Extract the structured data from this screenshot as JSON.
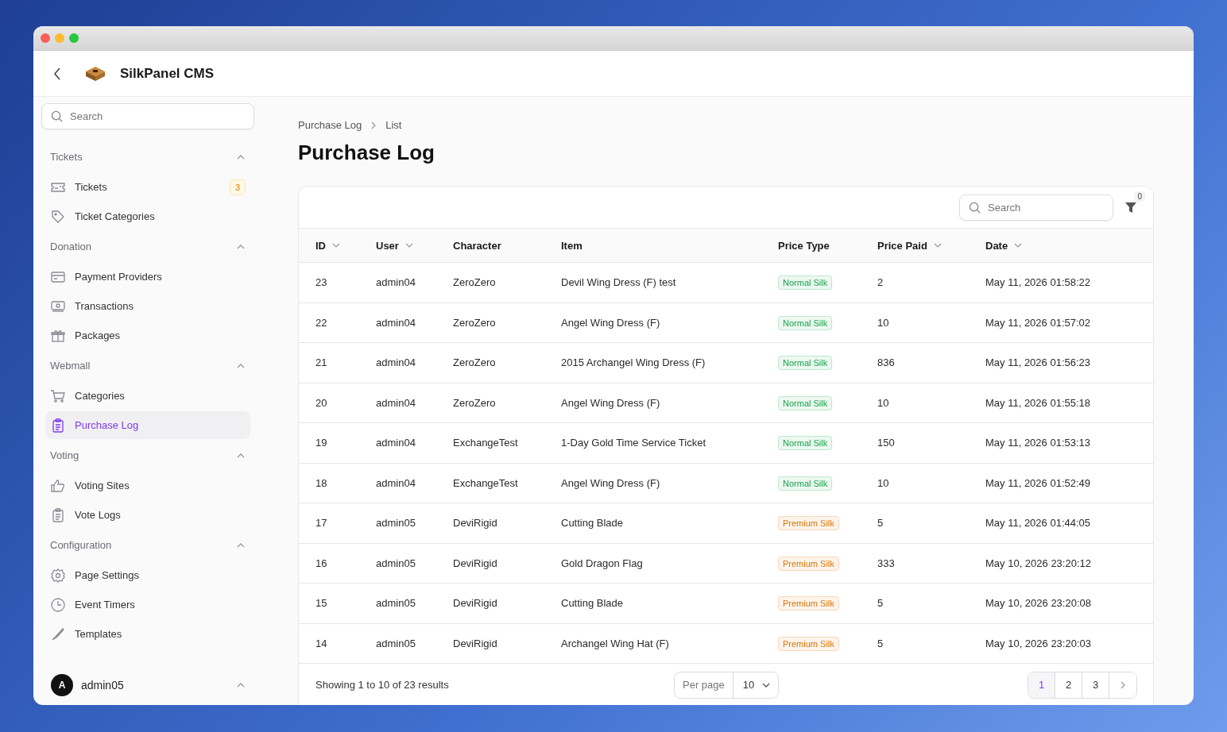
{
  "app": {
    "title": "SilkPanel CMS"
  },
  "sidebar": {
    "search": {
      "placeholder": "Search"
    },
    "groups": [
      {
        "label": "Tickets",
        "expanded": true,
        "items": [
          {
            "label": "Tickets",
            "selected": false,
            "badge": "3"
          },
          {
            "label": "Ticket Categories",
            "selected": false
          }
        ]
      },
      {
        "label": "Donation",
        "expanded": true,
        "items": [
          {
            "label": "Payment Providers",
            "selected": false
          },
          {
            "label": "Transactions",
            "selected": false
          },
          {
            "label": "Packages",
            "selected": false
          }
        ]
      },
      {
        "label": "Webmall",
        "expanded": true,
        "items": [
          {
            "label": "Categories",
            "selected": false
          },
          {
            "label": "Purchase Log",
            "selected": true
          }
        ]
      },
      {
        "label": "Voting",
        "expanded": true,
        "items": [
          {
            "label": "Voting Sites",
            "selected": false
          },
          {
            "label": "Vote Logs",
            "selected": false
          }
        ]
      },
      {
        "label": "Configuration",
        "expanded": true,
        "items": [
          {
            "label": "Page Settings",
            "selected": false
          },
          {
            "label": "Event Timers",
            "selected": false
          },
          {
            "label": "Templates",
            "selected": false
          }
        ]
      }
    ],
    "user": {
      "initial": "A",
      "name": "admin05"
    }
  },
  "breadcrumb": [
    "Purchase Log",
    "List"
  ],
  "page_title": "Purchase Log",
  "table": {
    "search": {
      "placeholder": "Search"
    },
    "filter_count": "0",
    "columns": [
      {
        "label": "ID",
        "sortable": true
      },
      {
        "label": "User",
        "sortable": true
      },
      {
        "label": "Character",
        "sortable": false
      },
      {
        "label": "Item",
        "sortable": false
      },
      {
        "label": "Price Type",
        "sortable": false
      },
      {
        "label": "Price Paid",
        "sortable": true
      },
      {
        "label": "Date",
        "sortable": true
      }
    ],
    "rows": [
      {
        "id": "23",
        "user": "admin04",
        "character": "ZeroZero",
        "item": "Devil Wing Dress (F) test",
        "price_type": {
          "label": "Normal Silk",
          "color": "#16a34a"
        },
        "price_paid": "2",
        "date": "May 11, 2026 01:58:22"
      },
      {
        "id": "22",
        "user": "admin04",
        "character": "ZeroZero",
        "item": "Angel Wing Dress (F)",
        "price_type": {
          "label": "Normal Silk",
          "color": "#16a34a"
        },
        "price_paid": "10",
        "date": "May 11, 2026 01:57:02"
      },
      {
        "id": "21",
        "user": "admin04",
        "character": "ZeroZero",
        "item": "2015 Archangel Wing Dress (F)",
        "price_type": {
          "label": "Normal Silk",
          "color": "#16a34a"
        },
        "price_paid": "836",
        "date": "May 11, 2026 01:56:23"
      },
      {
        "id": "20",
        "user": "admin04",
        "character": "ZeroZero",
        "item": "Angel Wing Dress (F)",
        "price_type": {
          "label": "Normal Silk",
          "color": "#16a34a"
        },
        "price_paid": "10",
        "date": "May 11, 2026 01:55:18"
      },
      {
        "id": "19",
        "user": "admin04",
        "character": "ExchangeTest",
        "item": "1-Day Gold Time Service Ticket",
        "price_type": {
          "label": "Normal Silk",
          "color": "#16a34a"
        },
        "price_paid": "150",
        "date": "May 11, 2026 01:53:13"
      },
      {
        "id": "18",
        "user": "admin04",
        "character": "ExchangeTest",
        "item": "Angel Wing Dress (F)",
        "price_type": {
          "label": "Normal Silk",
          "color": "#16a34a"
        },
        "price_paid": "10",
        "date": "May 11, 2026 01:52:49"
      },
      {
        "id": "17",
        "user": "admin05",
        "character": "DeviRigid",
        "item": "Cutting Blade",
        "price_type": {
          "label": "Premium Silk",
          "color": "#d97706"
        },
        "price_paid": "5",
        "date": "May 11, 2026 01:44:05"
      },
      {
        "id": "16",
        "user": "admin05",
        "character": "DeviRigid",
        "item": "Gold Dragon Flag",
        "price_type": {
          "label": "Premium Silk",
          "color": "#d97706"
        },
        "price_paid": "333",
        "date": "May 10, 2026 23:20:12"
      },
      {
        "id": "15",
        "user": "admin05",
        "character": "DeviRigid",
        "item": "Cutting Blade",
        "price_type": {
          "label": "Premium Silk",
          "color": "#d97706"
        },
        "price_paid": "5",
        "date": "May 10, 2026 23:20:08"
      },
      {
        "id": "14",
        "user": "admin05",
        "character": "DeviRigid",
        "item": "Archangel Wing Hat (F)",
        "price_type": {
          "label": "Premium Silk",
          "color": "#d97706"
        },
        "price_paid": "5",
        "date": "May 10, 2026 23:20:03"
      }
    ],
    "summary": "Showing 1 to 10 of 23 results",
    "per_page": {
      "label": "Per page",
      "value": "10"
    },
    "pages": [
      {
        "label": "1",
        "selected": true
      },
      {
        "label": "2",
        "selected": false
      },
      {
        "label": "3",
        "selected": false
      }
    ]
  }
}
